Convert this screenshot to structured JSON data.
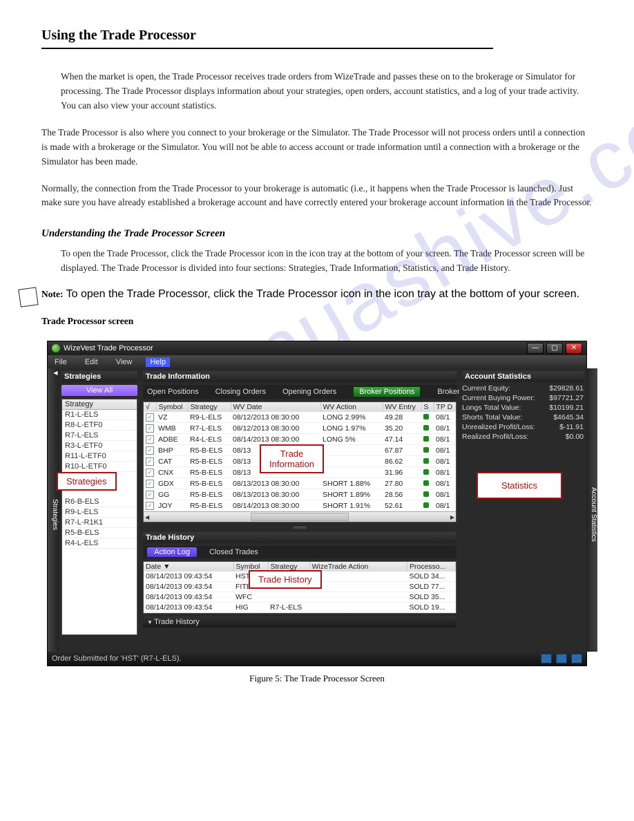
{
  "watermark": "monuashive.com",
  "doc": {
    "title": "Using the Trade Processor",
    "para1": "When the market is open, the Trade Processor receives trade orders from WizeTrade and passes these on to the brokerage or Simulator for processing. The Trade Processor displays information about your strategies, open orders, account statistics, and a log of your trade activity. You can also view your account statistics.",
    "para2": "The Trade Processor is also where you connect to your brokerage or the Simulator. The Trade Processor will not process orders until a connection is made with a brokerage or the Simulator. You will not be able to access account or trade information until a connection with a brokerage or the Simulator has been made.",
    "para3": "Normally, the connection from the Trade Processor to your brokerage is automatic (i.e., it happens when the Trade Processor is launched). Just make sure you have already established a brokerage account and have correctly entered your brokerage account information in the Trade Processor.",
    "heading2": "Understanding the Trade Processor Screen",
    "para4": "To open the Trade Processor, click the Trade Processor icon in the icon tray at the bottom of your screen. The Trade Processor screen will be displayed. The Trade Processor is divided into four sections: Strategies, Trade Information, Statistics, and Trade History.",
    "note_title": "Note:",
    "note_body": " To open the Trade Processor, click the Trade Processor icon in the icon tray at the bottom of your screen.",
    "heading3": "Trade Processor screen",
    "figure_caption": "Figure 5: The Trade Processor Screen"
  },
  "app": {
    "title": "WizeVest Trade Processor",
    "menus": [
      "File",
      "Edit",
      "View",
      "Help"
    ],
    "strategies_header": "Strategies",
    "viewall": "View All",
    "strategy_colhead": "Strategy",
    "strategies": [
      "R1-L-ELS",
      "R8-L-ETF0",
      "R7-L-ELS",
      "R3-L-ETF0",
      "R11-L-ETF0",
      "R10-L-ETF0",
      "",
      "R6-B-ELS",
      "R9-L-ELS",
      "R7-L-R1K1",
      "R5-B-ELS",
      "R4-L-ELS"
    ],
    "trade_info_header": "Trade Information",
    "trade_tabs": [
      "Open Positions",
      "Closing Orders",
      "Opening Orders",
      "Broker Positions",
      "Broker Orders"
    ],
    "trade_cols": [
      "√",
      "Symbol",
      "Strategy",
      "WV Date",
      "WV Action",
      "WV Entry",
      "S",
      "TP D"
    ],
    "trade_rows": [
      {
        "sym": "VZ",
        "strat": "R9-L-ELS",
        "date": "08/12/2013 08:30:00",
        "act": "LONG 2.99%",
        "entry": "49.28",
        "tp": "08/1"
      },
      {
        "sym": "WMB",
        "strat": "R7-L-ELS",
        "date": "08/12/2013 08:30:00",
        "act": "LONG 1.97%",
        "entry": "35.20",
        "tp": "08/1"
      },
      {
        "sym": "ADBE",
        "strat": "R4-L-ELS",
        "date": "08/14/2013 08:30:00",
        "act": "LONG 5%",
        "entry": "47.14",
        "tp": "08/1"
      },
      {
        "sym": "BHP",
        "strat": "R5-B-ELS",
        "date": "08/13",
        "act": "",
        "entry": "67.87",
        "tp": "08/1"
      },
      {
        "sym": "CAT",
        "strat": "R5-B-ELS",
        "date": "08/13",
        "act": "",
        "entry": "86.62",
        "tp": "08/1"
      },
      {
        "sym": "CNX",
        "strat": "R5-B-ELS",
        "date": "08/13",
        "act": "",
        "entry": "31.96",
        "tp": "08/1"
      },
      {
        "sym": "GDX",
        "strat": "R5-B-ELS",
        "date": "08/13/2013 08:30:00",
        "act": "SHORT 1.88%",
        "entry": "27.80",
        "tp": "08/1"
      },
      {
        "sym": "GG",
        "strat": "R5-B-ELS",
        "date": "08/13/2013 08:30:00",
        "act": "SHORT 1.89%",
        "entry": "28.56",
        "tp": "08/1"
      },
      {
        "sym": "JOY",
        "strat": "R5-B-ELS",
        "date": "08/14/2013 08:30:00",
        "act": "SHORT 1.91%",
        "entry": "52.61",
        "tp": "08/1"
      }
    ],
    "history_header": "Trade History",
    "history_tabs": [
      "Action Log",
      "Closed Trades"
    ],
    "history_cols": [
      "Date ▼",
      "Symbol",
      "Strategy",
      "WizeTrade Action",
      "Processo..."
    ],
    "history_rows": [
      {
        "date": "08/14/2013 09:43:54",
        "sym": "HST",
        "strat": "",
        "act": "",
        "proc": "SOLD 34..."
      },
      {
        "date": "08/14/2013 09:43:54",
        "sym": "FITB",
        "strat": "",
        "act": "",
        "proc": "SOLD 77..."
      },
      {
        "date": "08/14/2013 09:43:54",
        "sym": "WFC",
        "strat": "",
        "act": "",
        "proc": "SOLD 35..."
      },
      {
        "date": "08/14/2013 09:43:54",
        "sym": "HIG",
        "strat": "R7-L-ELS",
        "act": "",
        "proc": "SOLD 19..."
      }
    ],
    "collapse_label": "Trade History",
    "stats_header": "Account Statistics",
    "stats": [
      {
        "k": "Current Equity:",
        "v": "$29828.61"
      },
      {
        "k": "Current Buying Power:",
        "v": "$97721.27"
      },
      {
        "k": "Longs Total Value:",
        "v": "$10199.21"
      },
      {
        "k": "Shorts Total Value:",
        "v": "$4645.34"
      },
      {
        "k": "Unrealized Profit/Loss:",
        "v": "$-11.91"
      },
      {
        "k": "Realized Profit/Loss:",
        "v": "$0.00"
      }
    ],
    "side_left_label": "Strategies",
    "side_right_label": "Account Statistics",
    "statusbar": "Order Submitted for 'HST' (R7-L-ELS)."
  },
  "callouts": {
    "strategies": "Strategies",
    "tradeinfo": "Trade\nInformation",
    "statistics": "Statistics",
    "history": "Trade History"
  }
}
